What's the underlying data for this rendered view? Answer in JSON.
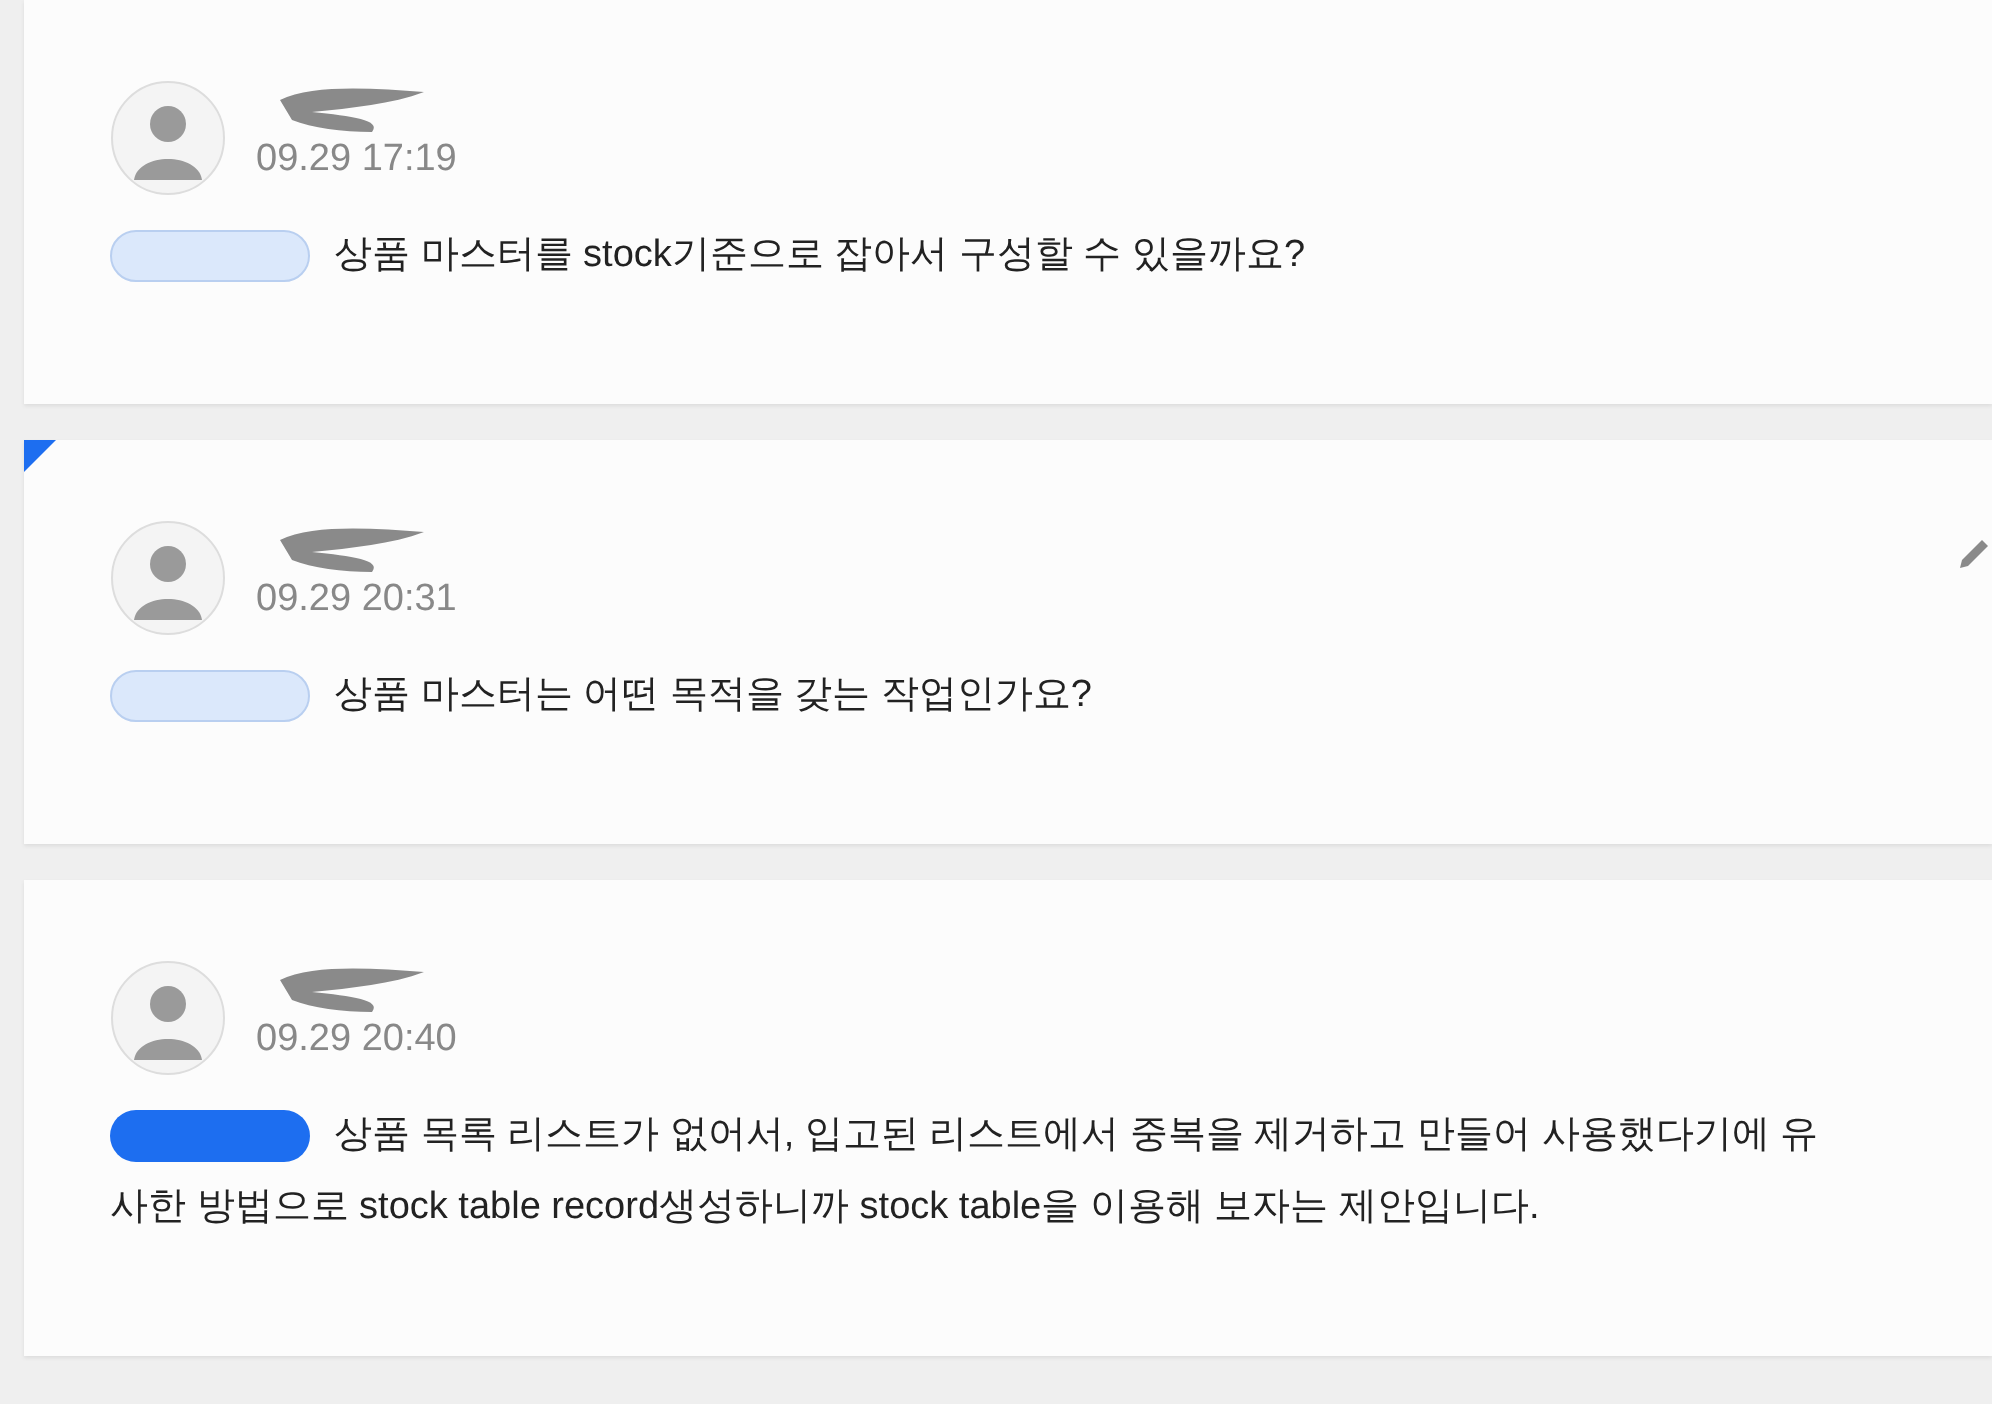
{
  "comments": [
    {
      "time": "09.29 17:19",
      "text": "상품 마스터를 stock기준으로 잡아서 구성할 수 있을까요?",
      "mention": {
        "highlighted": false
      },
      "marked": false,
      "editable": false
    },
    {
      "time": "09.29 20:31",
      "text": "상품 마스터는 어떤 목적을 갖는 작업인가요?",
      "mention": {
        "highlighted": false
      },
      "marked": true,
      "editable": true
    },
    {
      "time": "09.29 20:40",
      "text": "상품 목록 리스트가 없어서, 입고된 리스트에서 중복을 제거하고 만들어 사용했다기에 유사한 방법으로 stock table record생성하니까 stock table을 이용해 보자는 제안입니다.",
      "mention": {
        "highlighted": true
      },
      "marked": false,
      "editable": false
    }
  ]
}
